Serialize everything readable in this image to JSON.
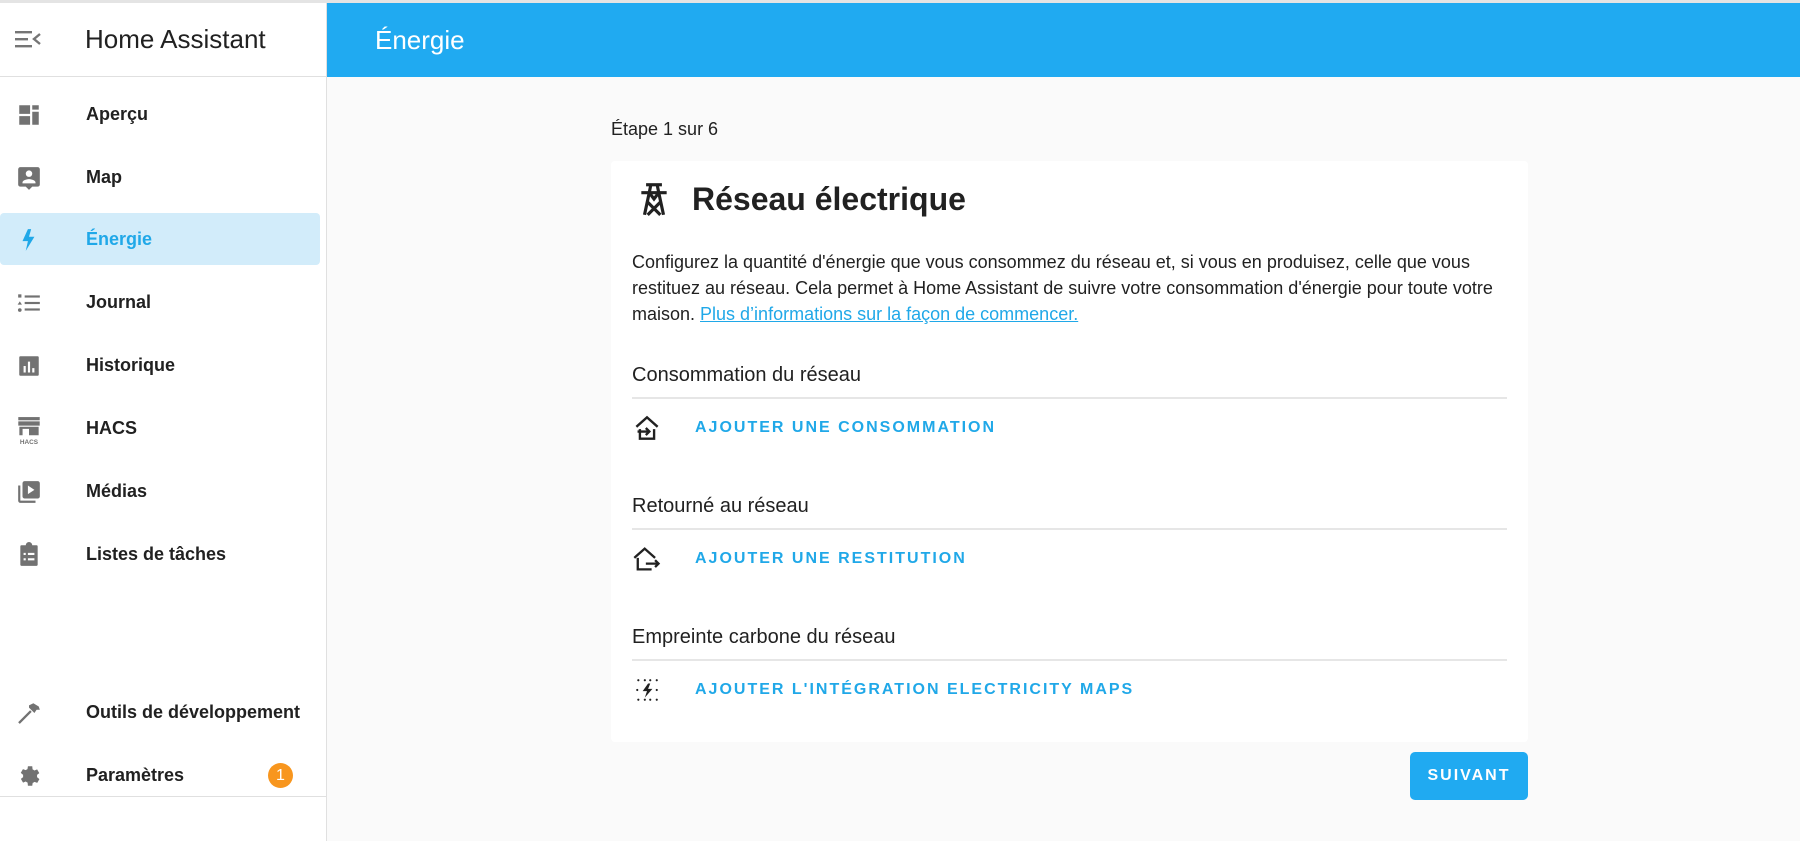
{
  "app": {
    "title": "Home Assistant"
  },
  "colors": {
    "primary": "#20aaf1",
    "active_bg": "#d2ecfa",
    "badge": "#f8961e"
  },
  "sidebar": {
    "items": [
      {
        "label": "Aperçu",
        "icon": "dashboard-icon",
        "active": false
      },
      {
        "label": "Map",
        "icon": "account-box-icon",
        "active": false
      },
      {
        "label": "Énergie",
        "icon": "lightning-bolt-icon",
        "active": true
      },
      {
        "label": "Journal",
        "icon": "format-list-bulleted-icon",
        "active": false
      },
      {
        "label": "Historique",
        "icon": "chart-box-icon",
        "active": false
      },
      {
        "label": "HACS",
        "icon": "hacs-store-icon",
        "active": false
      },
      {
        "label": "Médias",
        "icon": "play-box-multiple-icon",
        "active": false
      },
      {
        "label": "Listes de tâches",
        "icon": "clipboard-list-icon",
        "active": false
      }
    ],
    "bottom_items": [
      {
        "label": "Outils de développement",
        "icon": "hammer-icon"
      },
      {
        "label": "Paramètres",
        "icon": "cog-icon",
        "badge": "1"
      }
    ]
  },
  "header": {
    "title": "Énergie"
  },
  "wizard": {
    "step_label": "Étape 1 sur 6",
    "card": {
      "title": "Réseau électrique",
      "icon": "transmission-tower-icon",
      "description": "Configurez la quantité d'énergie que vous consommez du réseau et, si vous en produisez, celle que vous restituez au réseau. Cela permet à Home Assistant de suivre votre consommation d'énergie pour toute votre maison. ",
      "link_text": "Plus d’informations sur la façon de commencer.",
      "sections": [
        {
          "title": "Consommation du réseau",
          "action": "AJOUTER UNE CONSOMMATION",
          "icon": "home-import-icon"
        },
        {
          "title": "Retourné au réseau",
          "action": "AJOUTER UNE RESTITUTION",
          "icon": "home-export-icon"
        },
        {
          "title": "Empreinte carbone du réseau",
          "action": "AJOUTER L'INTÉGRATION ELECTRICITY MAPS",
          "icon": "lightning-dots-icon"
        }
      ]
    },
    "next_label": "SUIVANT"
  }
}
